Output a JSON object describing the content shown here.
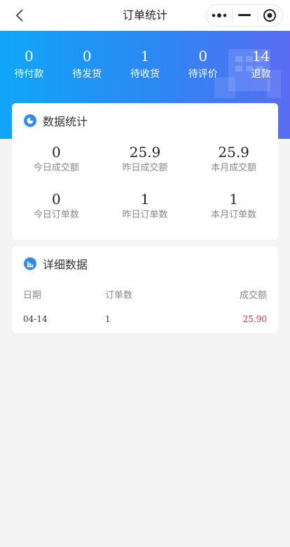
{
  "nav": {
    "title": "订单统计"
  },
  "summary": [
    {
      "value": "0",
      "label": "待付款"
    },
    {
      "value": "0",
      "label": "待发货"
    },
    {
      "value": "1",
      "label": "待收货"
    },
    {
      "value": "0",
      "label": "待评价"
    },
    {
      "value": "14",
      "label": "退款"
    }
  ],
  "stats_card": {
    "title": "数据统计",
    "items": [
      {
        "value": "0",
        "label": "今日成交额"
      },
      {
        "value": "25.9",
        "label": "昨日成交额"
      },
      {
        "value": "25.9",
        "label": "本月成交额"
      },
      {
        "value": "0",
        "label": "今日订单数"
      },
      {
        "value": "1",
        "label": "昨日订单数"
      },
      {
        "value": "1",
        "label": "本月订单数"
      }
    ]
  },
  "detail_card": {
    "title": "详细数据",
    "columns": [
      "日期",
      "订单数",
      "成交额"
    ],
    "rows": [
      {
        "date": "04-14",
        "orders": "1",
        "amount": "25.90"
      }
    ]
  },
  "colors": {
    "accent": "#2d8cf0",
    "amount": "#c8323a"
  },
  "icons": {
    "back": "chevron-left-icon",
    "more": "more-dots-icon",
    "minimize": "minus-icon",
    "close": "target-circle-icon",
    "stats": "pie-chart-icon",
    "detail": "bar-chart-icon"
  }
}
